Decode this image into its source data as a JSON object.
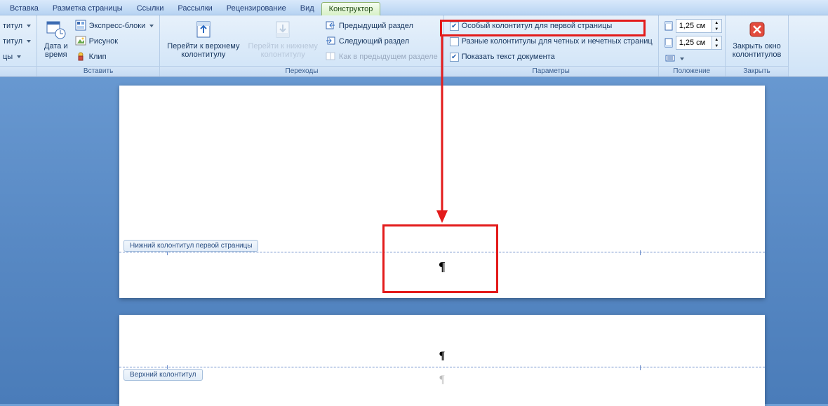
{
  "tabs": {
    "insert": "Вставка",
    "page_layout": "Разметка страницы",
    "references": "Ссылки",
    "mailings": "Рассылки",
    "review": "Рецензирование",
    "view": "Вид",
    "designer": "Конструктор"
  },
  "ribbon": {
    "titul_top": "титул",
    "titul_bot": "титул",
    "cy": "цы",
    "date_time": "Дата и\nвремя",
    "express_blocks": "Экспресс-блоки",
    "picture": "Рисунок",
    "clip": "Клип",
    "group_insert": "Вставить",
    "go_header": "Перейти к верхнему\nколонтитулу",
    "go_footer": "Перейти к нижнему\nколонтитулу",
    "prev_section": "Предыдущий раздел",
    "next_section": "Следующий раздел",
    "same_as_prev": "Как в предыдущем разделе",
    "group_nav": "Переходы",
    "opt_first_page": "Особый колонтитул для первой страницы",
    "opt_odd_even": "Разные колонтитулы для четных и нечетных страниц",
    "opt_show_doc": "Показать текст документа",
    "group_params": "Параметры",
    "pos_top": "1,25 см",
    "pos_bot": "1,25 см",
    "group_position": "Положение",
    "close_hf": "Закрыть окно\nколонтитулов",
    "group_close": "Закрыть"
  },
  "doc": {
    "footer_first_tag": "Нижний колонтитул первой страницы",
    "header_tag": "Верхний колонтитул",
    "pilcrow": "¶"
  }
}
